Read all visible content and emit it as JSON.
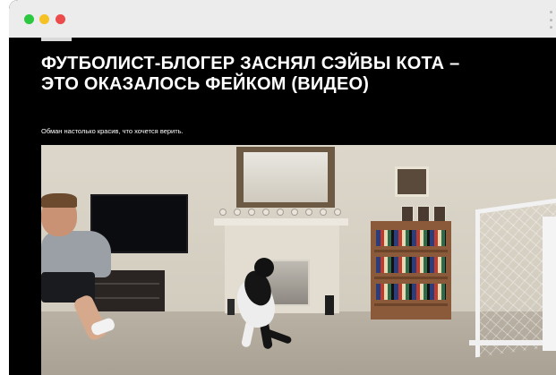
{
  "window": {
    "controls": [
      "close",
      "minimize",
      "maximize"
    ],
    "menu_icon": "kebab-menu-icon"
  },
  "article": {
    "headline": "ФУТБОЛИСТ-БЛОГЕР ЗАСНЯЛ СЭЙВЫ КОТА – ЭТО ОКАЗАЛОСЬ ФЕЙКОМ (ВИДЕО)",
    "subtitle": "Обман настолько красив, что хочется верить."
  },
  "colors": {
    "background": "#000000",
    "text": "#ffffff",
    "titlebar": "#ececec",
    "dot_green": "#2bc840",
    "dot_yellow": "#f5c124",
    "dot_red": "#ec4b4b"
  }
}
